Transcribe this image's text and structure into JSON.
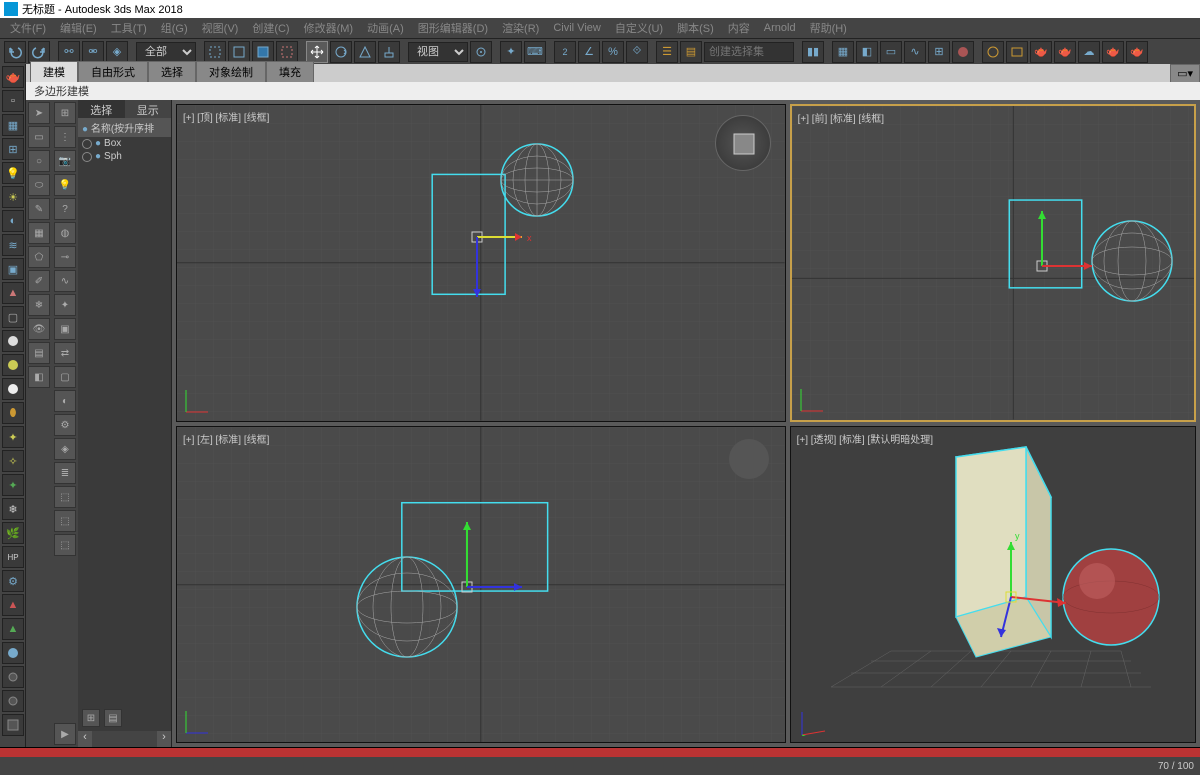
{
  "title_bar": {
    "title": "无标题 - Autodesk 3ds Max 2018"
  },
  "menu": {
    "items": [
      "文件(F)",
      "编辑(E)",
      "工具(T)",
      "组(G)",
      "视图(V)",
      "创建(C)",
      "修改器(M)",
      "动画(A)",
      "图形编辑器(D)",
      "渲染(R)",
      "Civil View",
      "自定义(U)",
      "脚本(S)",
      "内容",
      "Arnold",
      "帮助(H)"
    ]
  },
  "toolbar": {
    "viewport_combo": "全部",
    "view_label": "视图",
    "create_set": "创建选择集"
  },
  "ribbon": {
    "tabs": [
      "建模",
      "自由形式",
      "选择",
      "对象绘制",
      "填充"
    ],
    "active_tab": 0,
    "sub_label": "多边形建模"
  },
  "scene_explorer": {
    "tabs": [
      "选择",
      "显示"
    ],
    "active_tab": 0,
    "header": "名称(按升序排",
    "items": [
      {
        "name": "Box"
      },
      {
        "name": "Sph"
      }
    ]
  },
  "viewports": {
    "top": {
      "label": "[+] [顶] [标准] [线框]"
    },
    "front": {
      "label": "[+] [前] [标准] [线框]"
    },
    "left": {
      "label": "[+] [左] [标准] [线框]"
    },
    "persp": {
      "label": "[+] [透视] [标准] [默认明暗处理]"
    }
  },
  "status": {
    "frame_info": "70 / 100"
  },
  "left_rail_icons": [
    "teapot",
    "sel",
    "layer",
    "mat",
    "snap",
    "light",
    "sun",
    "iso",
    "wave",
    "cam",
    "mod",
    "snap2",
    "scale",
    "link",
    "box",
    "dot1",
    "dot2",
    "dot3",
    "cyl",
    "cone",
    "star",
    "star2",
    "tree",
    "tree2",
    "leaf",
    "hp",
    "set",
    "a",
    "tri",
    "dot4",
    "dot5",
    "dot6",
    "dot7"
  ],
  "palette1_icons": [
    "ptr",
    "rect",
    "circ",
    "lasso",
    "paint",
    "win",
    "poly",
    "brush",
    "freeze",
    "vis",
    "name",
    "layer"
  ],
  "palette2_icons": [
    "se",
    "hier",
    "cam",
    "light",
    "help",
    "obj",
    "bone",
    "spline",
    "part",
    "grp",
    "xref",
    "cont",
    "mat",
    "mod",
    "sh",
    "lay",
    "unk",
    "tag",
    "nav",
    "play"
  ]
}
